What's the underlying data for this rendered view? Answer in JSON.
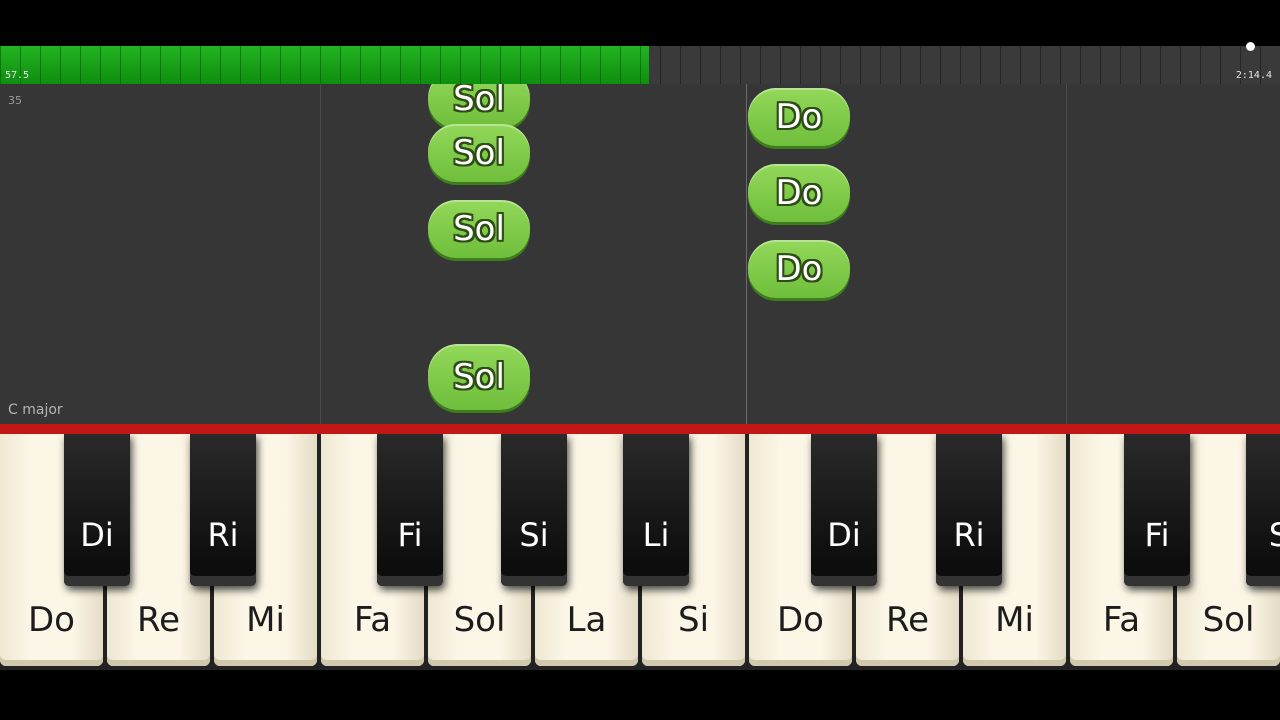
{
  "progress": {
    "elapsed": "57.5",
    "total": "2:14.4",
    "fraction": 0.507,
    "color": "#16a016"
  },
  "lane": {
    "measure_number": "35",
    "key_signature": "C major"
  },
  "falling_notes": [
    "Sol",
    "Sol",
    "Sol",
    "Sol",
    "Do",
    "Do",
    "Do"
  ],
  "keyboard": {
    "white_keys": [
      "Do",
      "Re",
      "Mi",
      "Fa",
      "Sol",
      "La",
      "Si",
      "Do",
      "Re",
      "Mi",
      "Fa",
      "Sol"
    ],
    "black_keys": [
      "Di",
      "Ri",
      "Fi",
      "Si",
      "Li",
      "Di",
      "Ri",
      "Fi",
      "S"
    ],
    "accent_color": "#c41616"
  }
}
